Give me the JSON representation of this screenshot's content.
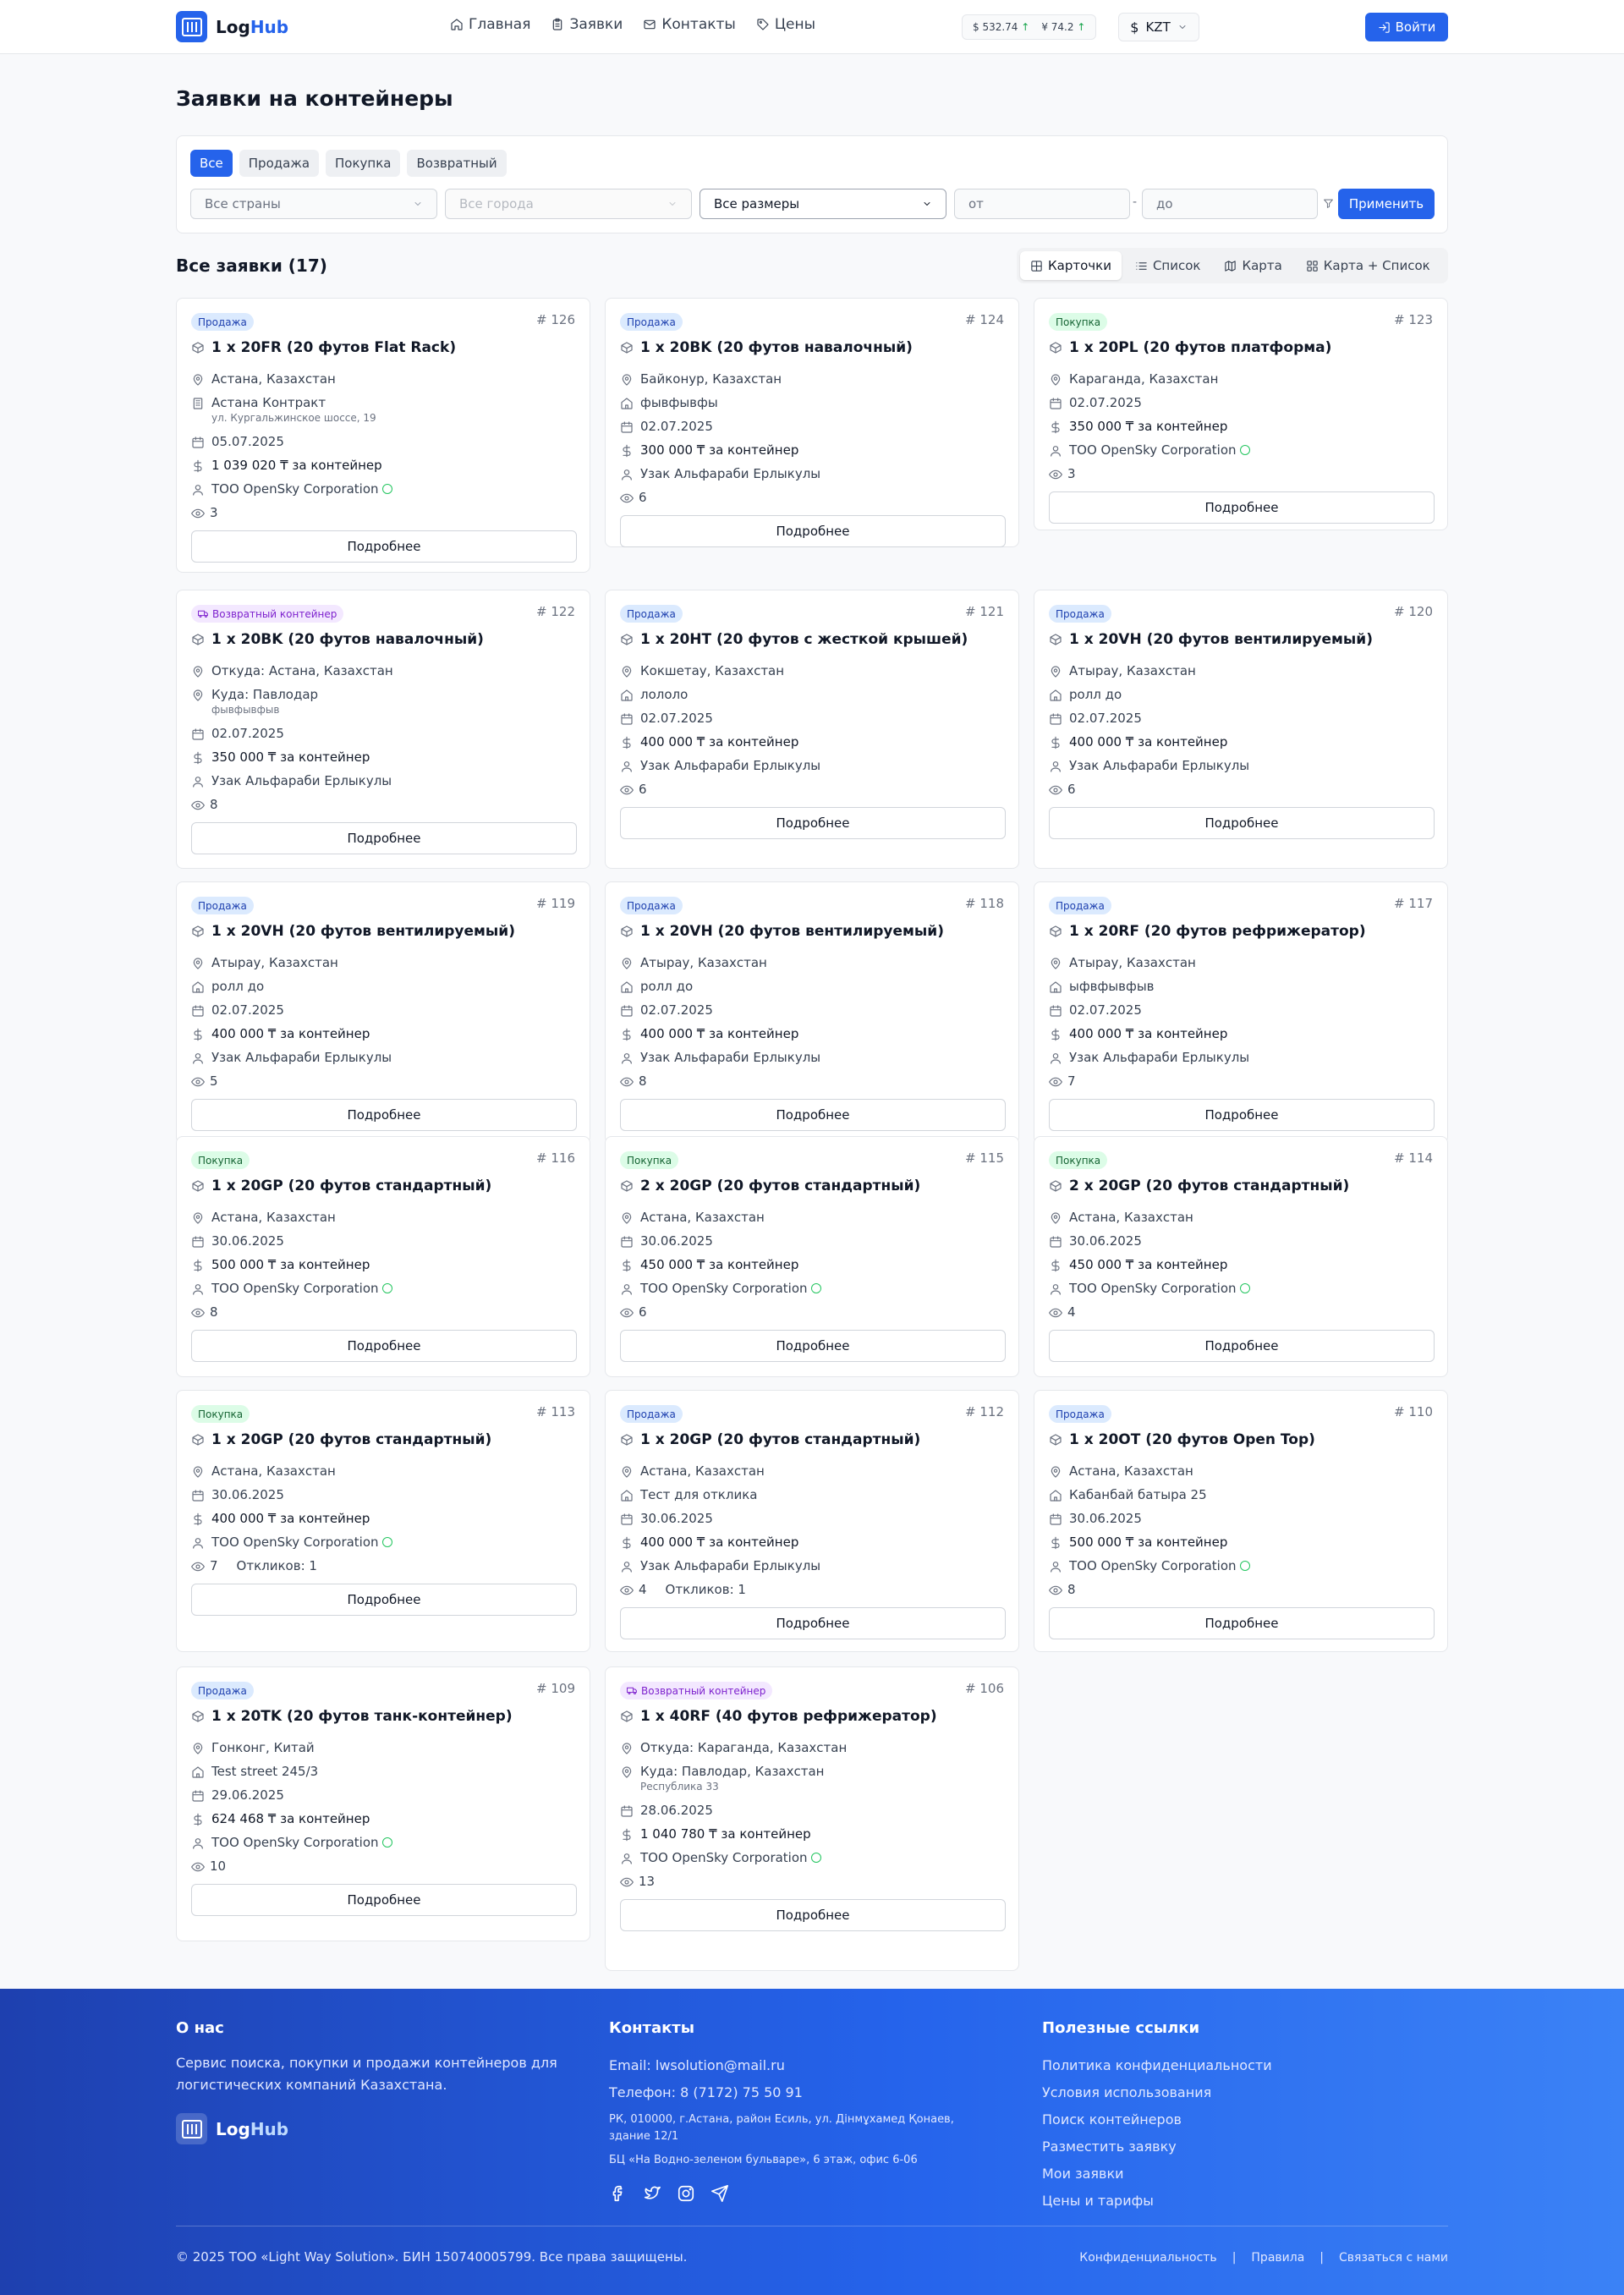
{
  "header": {
    "logo_a": "Log",
    "logo_b": "Hub",
    "nav": [
      "Главная",
      "Заявки",
      "Контакты",
      "Цены"
    ],
    "rate_usd": "$ 532.74",
    "rate_cny": "¥ 74.2",
    "rate_up": "↑",
    "currency": "KZT",
    "login": "Войти"
  },
  "page": {
    "title": "Заявки на контейнеры",
    "tabs": [
      "Все",
      "Продажа",
      "Покупка",
      "Возвратный"
    ],
    "filters": {
      "country": "Все страны",
      "city": "Все города",
      "size": "Все размеры",
      "from": "от",
      "to": "до",
      "dash": "-",
      "apply": "Применить"
    },
    "list_title": "Все заявки (17)",
    "views": [
      "Карточки",
      "Список",
      "Карта",
      "Карта + Список"
    ]
  },
  "cards": [
    {
      "badge": "Продажа",
      "id": "# 126",
      "title": "1 x 20FR (20 футов Flat Rack)",
      "city": "Астана, Казахстан",
      "place": "Астана Контракт",
      "place_sub": "ул. Кургальжинское шоссе, 19",
      "date": "05.07.2025",
      "price": "1 039 020 ₸ за контейнер",
      "owner": "ТОО OpenSky Corporation",
      "views": "3",
      "more": "Подробнее"
    },
    {
      "badge": "Продажа",
      "id": "# 124",
      "title": "1 x 20BK (20 футов навалочный)",
      "city": "Байконур, Казахстан",
      "place": "фывфывфы",
      "date": "02.07.2025",
      "price": "300 000 ₸ за контейнер",
      "owner": "Узак Альфараби Ерлыкулы",
      "views": "6",
      "more": "Подробнее"
    },
    {
      "badge": "Покупка",
      "id": "# 123",
      "title": "1 x 20PL (20 футов платформа)",
      "city": "Караганда, Казахстан",
      "date": "02.07.2025",
      "price": "350 000 ₸ за контейнер",
      "owner": "ТОО OpenSky Corporation",
      "views": "3",
      "more": "Подробнее"
    },
    {
      "badge": "Возвратный контейнер",
      "id": "# 122",
      "title": "1 x 20BK (20 футов навалочный)",
      "city": "Откуда: Астана, Казахстан",
      "place": "Куда: Павлодар",
      "place_sub": "фывфывфыв",
      "date": "02.07.2025",
      "price": "350 000 ₸ за контейнер",
      "owner": "Узак Альфараби Ерлыкулы",
      "views": "8",
      "more": "Подробнее"
    },
    {
      "badge": "Продажа",
      "id": "# 121",
      "title": "1 x 20HT (20 футов с жесткой крышей)",
      "city": "Кокшетау, Казахстан",
      "place": "лололо",
      "date": "02.07.2025",
      "price": "400 000 ₸ за контейнер",
      "owner": "Узак Альфараби Ерлыкулы",
      "views": "6",
      "more": "Подробнее"
    },
    {
      "badge": "Продажа",
      "id": "# 120",
      "title": "1 x 20VH (20 футов вентилируемый)",
      "city": "Атырау, Казахстан",
      "place": "ролл до",
      "date": "02.07.2025",
      "price": "400 000 ₸ за контейнер",
      "owner": "Узак Альфараби Ерлыкулы",
      "views": "6",
      "more": "Подробнее"
    },
    {
      "badge": "Продажа",
      "id": "# 119",
      "title": "1 x 20VH (20 футов вентилируемый)",
      "city": "Атырау, Казахстан",
      "place": "ролл до",
      "date": "02.07.2025",
      "price": "400 000 ₸ за контейнер",
      "owner": "Узак Альфараби Ерлыкулы",
      "views": "5",
      "more": "Подробнее"
    },
    {
      "badge": "Продажа",
      "id": "# 118",
      "title": "1 x 20VH (20 футов вентилируемый)",
      "city": "Атырау, Казахстан",
      "place": "ролл до",
      "date": "02.07.2025",
      "price": "400 000 ₸ за контейнер",
      "owner": "Узак Альфараби Ерлыкулы",
      "views": "8",
      "more": "Подробнее"
    },
    {
      "badge": "Продажа",
      "id": "# 117",
      "title": "1 x 20RF (20 футов рефрижератор)",
      "city": "Атырау, Казахстан",
      "place": "ыфвфывфыв",
      "date": "02.07.2025",
      "price": "400 000 ₸ за контейнер",
      "owner": "Узак Альфараби Ерлыкулы",
      "views": "7",
      "more": "Подробнее"
    },
    {
      "badge": "Покупка",
      "id": "# 116",
      "title": "1 x 20GP (20 футов стандартный)",
      "city": "Астана, Казахстан",
      "date": "30.06.2025",
      "price": "500 000 ₸ за контейнер",
      "owner": "ТОО OpenSky Corporation",
      "views": "8",
      "more": "Подробнее"
    },
    {
      "badge": "Покупка",
      "id": "# 115",
      "title": "2 x 20GP (20 футов стандартный)",
      "city": "Астана, Казахстан",
      "date": "30.06.2025",
      "price": "450 000 ₸ за контейнер",
      "owner": "ТОО OpenSky Corporation",
      "views": "6",
      "more": "Подробнее"
    },
    {
      "badge": "Покупка",
      "id": "# 114",
      "title": "2 x 20GP (20 футов стандартный)",
      "city": "Астана, Казахстан",
      "date": "30.06.2025",
      "price": "450 000 ₸ за контейнер",
      "owner": "ТОО OpenSky Corporation",
      "views": "4",
      "more": "Подробнее"
    },
    {
      "badge": "Покупка",
      "id": "# 113",
      "title": "1 x 20GP (20 футов стандартный)",
      "city": "Астана, Казахстан",
      "date": "30.06.2025",
      "price": "400 000 ₸ за контейнер",
      "owner": "ТОО OpenSky Corporation",
      "views": "7",
      "responses": "Откликов:  1",
      "more": "Подробнее"
    },
    {
      "badge": "Продажа",
      "id": "# 112",
      "title": "1 x 20GP (20 футов стандартный)",
      "city": "Астана, Казахстан",
      "place": "Тест для отклика",
      "date": "30.06.2025",
      "price": "400 000 ₸ за контейнер",
      "owner": "Узак Альфараби Ерлыкулы",
      "views": "4",
      "responses": "Откликов:  1",
      "more": "Подробнее"
    },
    {
      "badge": "Продажа",
      "id": "# 110",
      "title": "1 x 20OT (20 футов Open Top)",
      "city": "Астана, Казахстан",
      "place": "Кабанбай батыра 25",
      "date": "30.06.2025",
      "price": "500 000 ₸ за контейнер",
      "owner": "ТОО OpenSky Corporation",
      "views": "8",
      "more": "Подробнее"
    },
    {
      "badge": "Продажа",
      "id": "# 109",
      "title": "1 x 20TK (20 футов танк-контейнер)",
      "city": "Гонконг, Китай",
      "place": "Test street 245/3",
      "date": "29.06.2025",
      "price": "624 468 ₸ за контейнер",
      "owner": "ТОО OpenSky Corporation",
      "views": "10",
      "more": "Подробнее"
    },
    {
      "badge": "Возвратный контейнер",
      "id": "# 106",
      "title": "1 x 40RF (40 футов рефрижератор)",
      "city": "Откуда: Караганда, Казахстан",
      "place": "Куда: Павлодар, Казахстан",
      "place_sub": "Республика 33",
      "date": "28.06.2025",
      "price": "1 040 780 ₸ за контейнер",
      "owner": "ТОО OpenSky Corporation",
      "views": "13",
      "more": "Подробнее"
    }
  ],
  "footer": {
    "about_title": "О нас",
    "about_text": "Сервис поиска, покупки и продажи контейнеров для логистических компаний Казахстана.",
    "contacts_title": "Контакты",
    "email": "Email: lwsolution@mail.ru",
    "phone": "Телефон: 8 (7172) 75 50 91",
    "address": "РК, 010000, г.Астана, район Есиль, ул. Дінмұхамед Қонаев, здание 12/1",
    "office": "БЦ «На Водно-зеленом бульваре», 6 этаж, офис 6-06",
    "links_title": "Полезные ссылки",
    "links": [
      "Политика конфиденциальности",
      "Условия использования",
      "Поиск контейнеров",
      "Разместить заявку",
      "Мои заявки",
      "Цены и тарифы"
    ],
    "copyright": "© 2025 ТОО «Light Way Solution». БИН 150740005799. Все права защищены.",
    "bottom_links": [
      "Конфиденциальность",
      "|",
      "Правила",
      "|",
      "Связаться с нами"
    ]
  }
}
